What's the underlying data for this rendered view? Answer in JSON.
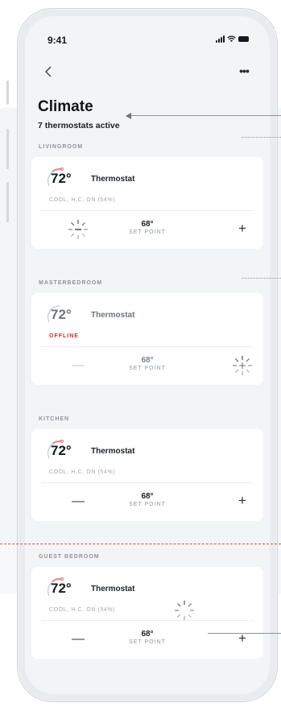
{
  "status_bar": {
    "time": "9:41"
  },
  "nav": {
    "back_icon": "chevron-left-icon",
    "more_label": "•••"
  },
  "header": {
    "title": "Climate",
    "subtitle": "7 thermostats active"
  },
  "rooms": [
    {
      "section": "LIVINGROOM",
      "temperature": "72°",
      "name": "Thermostat",
      "status": "COOL, H.C. ON (54%)",
      "setpoint_value": "68°",
      "setpoint_label": "SET POINT",
      "loading_control": "minus"
    },
    {
      "section": "MASTERBEDROOM",
      "temperature": "72°",
      "name": "Thermostat",
      "status": "OFFLINE",
      "setpoint_value": "68°",
      "setpoint_label": "SET POINT",
      "loading_control": "plus"
    },
    {
      "section": "KITCHEN",
      "temperature": "72°",
      "name": "Thermostat",
      "status": "COOL, H.C. ON (54%)",
      "setpoint_value": "68°",
      "setpoint_label": "SET POINT",
      "loading_control": "none"
    },
    {
      "section": "GUEST BEDROOM",
      "temperature": "72°",
      "name": "Thermostat",
      "status": "COOL, H.C. ON (54%)",
      "setpoint_value": "68°",
      "setpoint_label": "SET POINT",
      "loading_control": "status"
    }
  ],
  "controls": {
    "minus": "—",
    "plus": "+"
  },
  "colors": {
    "accent_red": "#d52b2b",
    "dial_arc": "#e37a7a",
    "card_bg": "#ffffff",
    "screen_bg": "#f3f4f6"
  }
}
